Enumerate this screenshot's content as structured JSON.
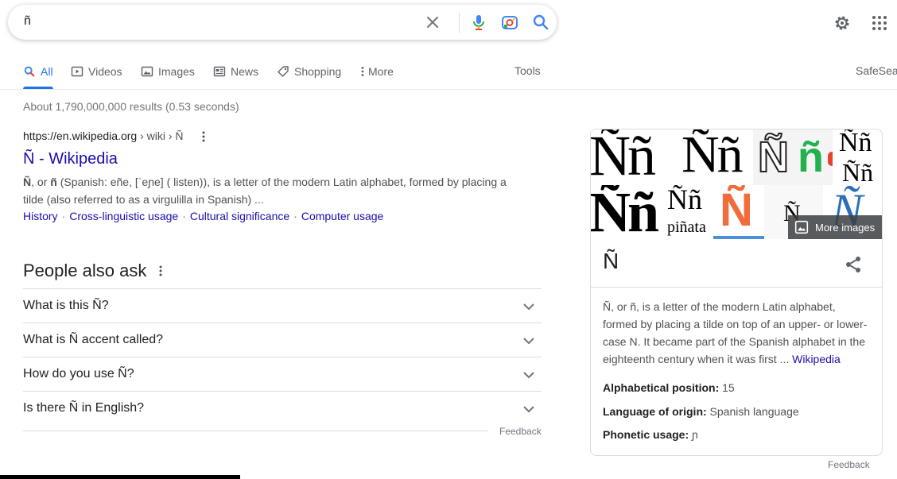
{
  "search": {
    "query": "ñ"
  },
  "tabs": [
    {
      "label": "All",
      "icon": "search-icon"
    },
    {
      "label": "Videos",
      "icon": "video-icon"
    },
    {
      "label": "Images",
      "icon": "image-icon"
    },
    {
      "label": "News",
      "icon": "news-icon"
    },
    {
      "label": "Shopping",
      "icon": "tag-icon"
    },
    {
      "label": "More",
      "icon": "kebab-icon"
    }
  ],
  "tools_label": "Tools",
  "safesearch_label": "SafeSea",
  "results_stats": "About 1,790,000,000 results (0.53 seconds)",
  "result": {
    "url_host": "https://en.wikipedia.org",
    "url_path": " › wiki › Ñ",
    "title": "Ñ - Wikipedia",
    "snippet_1_bold": "Ñ",
    "snippet_1a": ", or ",
    "snippet_1_bold2": "ñ",
    "snippet_1b": " (Spanish: eñe, [ˈeɲe] ( listen)), is a letter of the modern Latin alphabet, formed by placing a tilde (also referred to as a virgulilla in Spanish) ...",
    "sitelinks": [
      "History",
      "Cross-linguistic usage",
      "Cultural significance",
      "Computer usage"
    ]
  },
  "paa": {
    "heading": "People also ask",
    "questions": [
      "What is this Ñ?",
      "What is Ñ accent called?",
      "How do you use Ñ?",
      "Is there Ñ in English?"
    ],
    "feedback": "Feedback"
  },
  "knowledge_panel": {
    "image_glyphs": [
      "Ññ",
      "Ññ",
      "Ññ",
      "Ññ",
      "Ññ",
      "piñata",
      "Ñ",
      "Ñ",
      "Ñ"
    ],
    "more_images": "More images",
    "title": "Ñ",
    "description": "Ñ, or ñ, is a letter of the modern Latin alphabet, formed by placing a tilde on top of an upper- or lower-case N. It became part of the Spanish alphabet in the eighteenth century when it was first ...",
    "description_link": "Wikipedia",
    "facts": [
      {
        "label": "Alphabetical position:",
        "value": "15"
      },
      {
        "label": "Language of origin:",
        "value": "Spanish language"
      },
      {
        "label": "Phonetic usage:",
        "value": "ɲ"
      }
    ],
    "feedback": "Feedback"
  },
  "colors": {
    "link": "#1a0dab",
    "accent": "#1a73e8",
    "text_secondary": "#4d5156"
  }
}
